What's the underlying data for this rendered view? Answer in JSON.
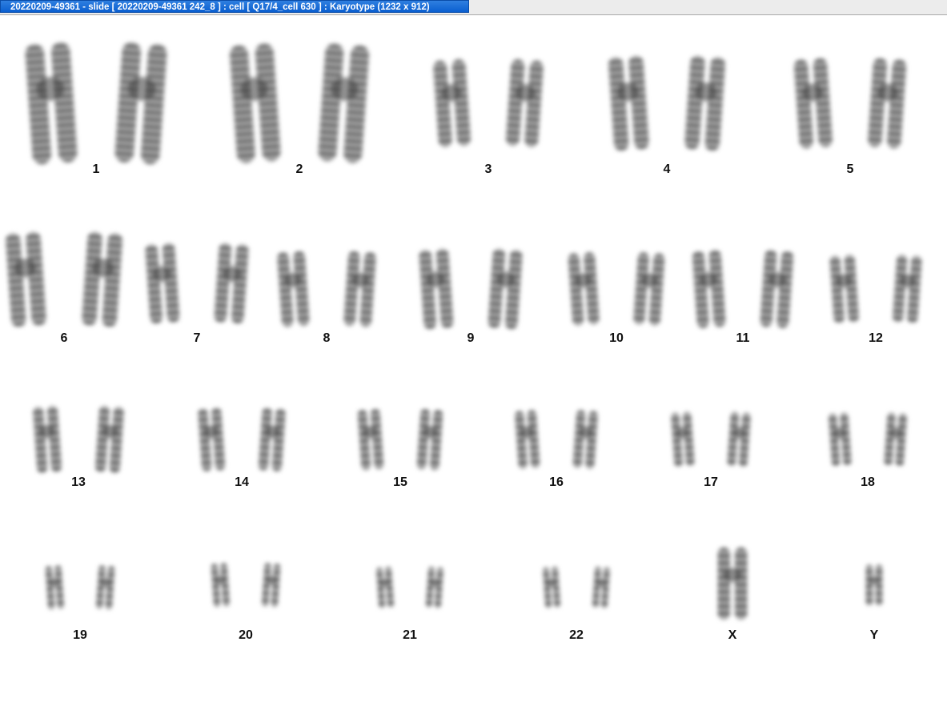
{
  "window": {
    "title": "20220209-49361 - slide [ 20220209-49361 242_8 ] : cell [ Q17/4_cell 630 ] : Karyotype  (1232 x 912)"
  },
  "karyotype": {
    "ink_color": "#3a3a3a",
    "chromosomes": [
      {
        "label": "1",
        "type": "large"
      },
      {
        "label": "2",
        "type": "large"
      },
      {
        "label": "3",
        "type": "medium"
      },
      {
        "label": "4",
        "type": "medium"
      },
      {
        "label": "5",
        "type": "medium"
      },
      {
        "label": "6",
        "type": "medium"
      },
      {
        "label": "7",
        "type": "medium"
      },
      {
        "label": "8",
        "type": "medium"
      },
      {
        "label": "9",
        "type": "medium"
      },
      {
        "label": "10",
        "type": "medium"
      },
      {
        "label": "11",
        "type": "medium"
      },
      {
        "label": "12",
        "type": "medium"
      },
      {
        "label": "13",
        "type": "acro"
      },
      {
        "label": "14",
        "type": "acro"
      },
      {
        "label": "15",
        "type": "acro"
      },
      {
        "label": "16",
        "type": "small"
      },
      {
        "label": "17",
        "type": "small"
      },
      {
        "label": "18",
        "type": "small"
      },
      {
        "label": "19",
        "type": "tiny"
      },
      {
        "label": "20",
        "type": "tiny"
      },
      {
        "label": "21",
        "type": "tiny-acro"
      },
      {
        "label": "22",
        "type": "tiny-acro"
      },
      {
        "label": "X",
        "type": "single-medium"
      },
      {
        "label": "Y",
        "type": "single-tiny"
      }
    ]
  }
}
